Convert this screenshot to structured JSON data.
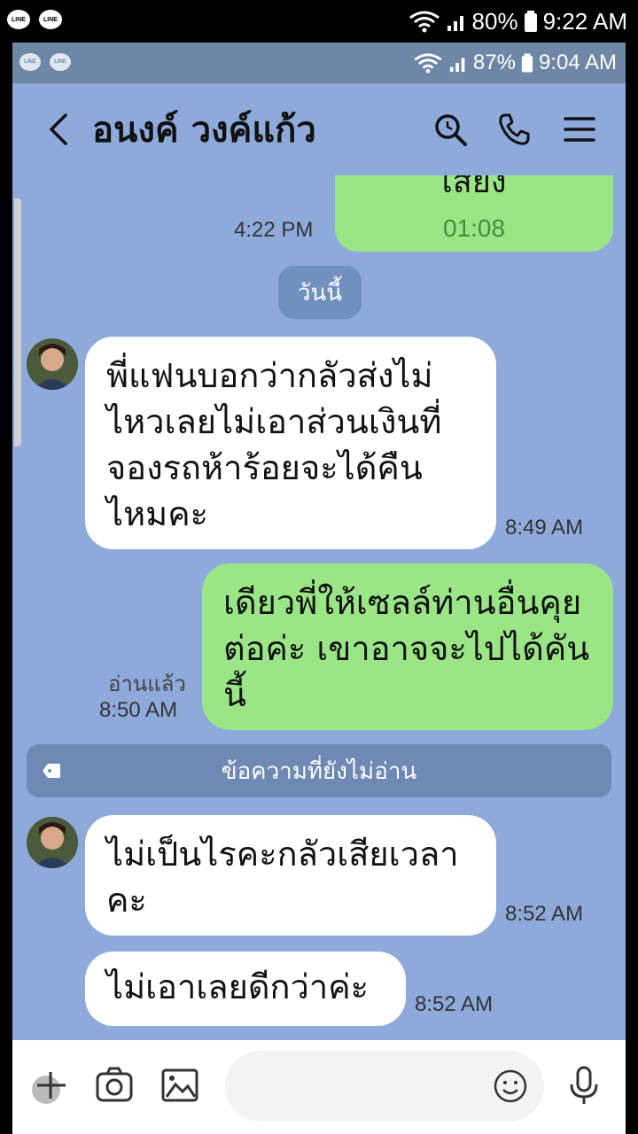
{
  "outer_status": {
    "app_badges": [
      "LINE",
      "LINE"
    ],
    "battery": "80%",
    "time": "9:22 AM"
  },
  "inner_status": {
    "app_badges": [
      "LINE",
      "LINE"
    ],
    "battery": "87%",
    "time": "9:04 AM"
  },
  "header": {
    "contact_name": "อนงค์ วงค์แก้ว"
  },
  "colors": {
    "background": "#8eaadb",
    "sent_bubble": "#9ae687",
    "received_bubble": "#ffffff",
    "header_status": "#6f87a6"
  },
  "messages": [
    {
      "id": "voice",
      "type": "sent",
      "text": "เสียง",
      "duration": "01:08",
      "time": "4:22 PM"
    },
    {
      "id": "m1",
      "type": "received",
      "text": "พี่แฟนบอกว่ากลัวส่งไม่ไหวเลยไม่เอาส่วนเงินที่จองรถห้าร้อยจะได้คืนไหมคะ",
      "time": "8:49 AM"
    },
    {
      "id": "m2",
      "type": "sent",
      "text": "เดียวพี่ให้เซลล์ท่านอื่นคุยต่อค่ะ เขาอาจจะไปได้คันนี้",
      "read": "อ่านแล้ว",
      "time": "8:50 AM"
    },
    {
      "id": "m3",
      "type": "received",
      "text": "ไม่เป็นไรคะกลัวเสียเวลาคะ",
      "time": "8:52 AM"
    },
    {
      "id": "m4",
      "type": "received",
      "text": "ไม่เอาเลยดีกว่าค่ะ",
      "time": "8:52 AM"
    }
  ],
  "date_divider": "วันนี้",
  "unread_divider": "ข้อความที่ยังไม่อ่าน",
  "input": {
    "placeholder": ""
  },
  "icons": [
    "back-icon",
    "search-icon",
    "phone-icon",
    "menu-icon",
    "plus-icon",
    "camera-icon",
    "image-icon",
    "emoji-icon",
    "mic-icon",
    "tag-icon"
  ]
}
